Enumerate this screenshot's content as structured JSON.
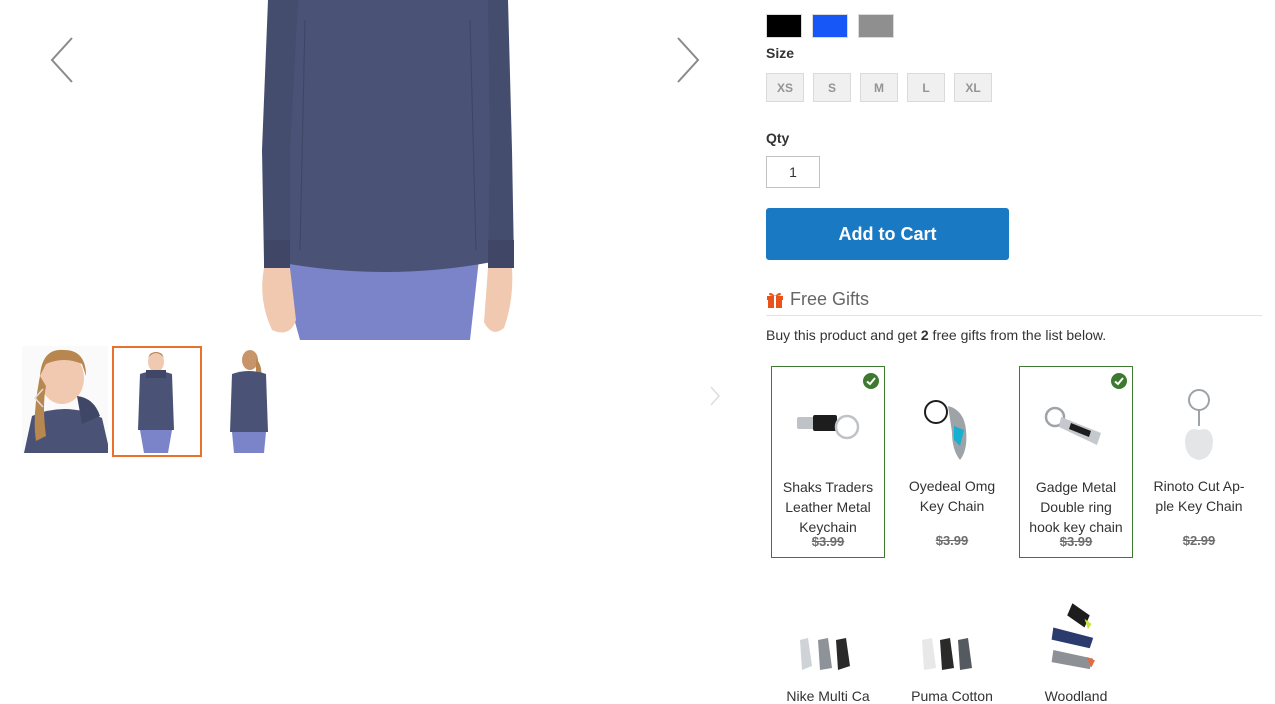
{
  "colors": {
    "brand_blue": "#1979c3",
    "active_thumb_border": "#e8722b",
    "gift_selected_border": "#3d7a2f",
    "gift_icon": "#e8521b"
  },
  "gallery": {
    "prev_icon": "chevron-left-icon",
    "next_icon": "chevron-right-icon",
    "thumbnails": [
      {
        "name": "front view with face",
        "active": false
      },
      {
        "name": "front view",
        "active": true
      },
      {
        "name": "back view",
        "active": false
      }
    ]
  },
  "swatches": {
    "colors": [
      {
        "name": "Black",
        "hex": "#000000"
      },
      {
        "name": "Blue",
        "hex": "#1857f7"
      },
      {
        "name": "Gray",
        "hex": "#8f8f8f"
      }
    ],
    "size_label": "Size",
    "sizes": [
      "XS",
      "S",
      "M",
      "L",
      "XL"
    ]
  },
  "qty": {
    "label": "Qty",
    "value": "1"
  },
  "add_to_cart": {
    "label": "Add to Cart"
  },
  "free_gifts": {
    "title": "Free Gifts",
    "icon": "gift-icon",
    "desc_prefix": "Buy this product and get ",
    "count": "2",
    "desc_suffix": " free gifts from the list below.",
    "items": [
      {
        "name": "Shaks Traders Leather Metal Keychain",
        "price": "$3.99",
        "selected": true
      },
      {
        "name": "Oyedeal Omg Key Chain",
        "price": "$3.99",
        "selected": false
      },
      {
        "name": "Gadge Metal Double ring hook key chain",
        "price": "$3.99",
        "selected": true
      },
      {
        "name": "Rinoto Cut Ap-ple Key Chain",
        "price": "$2.99",
        "selected": false
      }
    ],
    "items_row2": [
      {
        "name": "Nike Multi Ca"
      },
      {
        "name": "Puma Cotton"
      },
      {
        "name": "Woodland"
      }
    ]
  }
}
